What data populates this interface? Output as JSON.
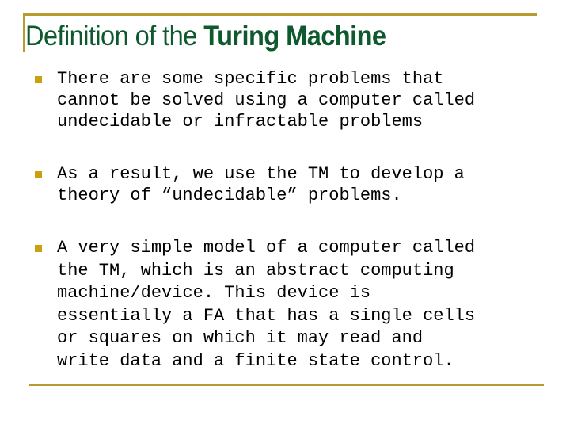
{
  "slide": {
    "title_regular": "Definition of the ",
    "title_bold": "Turing Machine",
    "colors": {
      "accent_rule": "#B89A2E",
      "title": "#0E5A2E",
      "bullet": "#C9A010",
      "text": "#000000"
    },
    "bullets": [
      {
        "icon": "square-bullet-icon",
        "lines": [
          "There are some specific problems that",
          "cannot be solved using a computer called",
          "undecidable or infractable problems"
        ]
      },
      {
        "icon": "square-bullet-icon",
        "lines": [
          "As a result, we use the TM to develop a",
          "theory of “undecidable” problems."
        ]
      },
      {
        "icon": "square-bullet-icon",
        "lines": [
          "A very simple model of a computer called",
          "the TM, which is an abstract computing",
          "machine/device. This device is",
          "essentially a FA that has a single cells",
          "or squares on which it may read and",
          "write data and a finite state control."
        ]
      }
    ]
  }
}
